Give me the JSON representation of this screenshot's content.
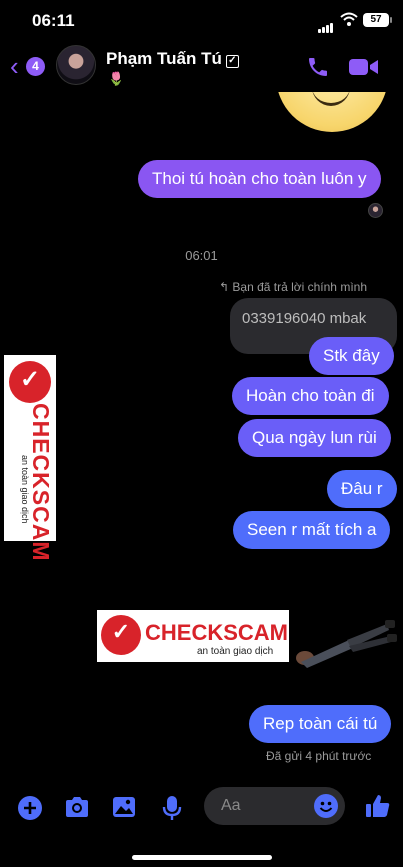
{
  "status_bar": {
    "time": "06:11",
    "battery": "57"
  },
  "header": {
    "back_count": "4",
    "contact_name": "Phạm Tuấn Tú",
    "status_emoji": "🌷"
  },
  "messages": {
    "m1": "Thoi tú hoàn cho toàn luôn y",
    "timestamp": "06:01",
    "reply_note": "↰ Bạn đã trả lời chính mình",
    "quoted": "0339196040 mbak",
    "m2": "Stk đây",
    "m3": "Hoàn cho toàn đi",
    "m4": "Qua ngày lun rùi",
    "m5": "Đâu r",
    "m6": "Seen r mất tích a",
    "m7": "Rep toàn cái tú",
    "sent_status": "Đã gửi 4 phút trước"
  },
  "watermark": {
    "brand": "CHECKSCAM",
    "tagline": "an toàn giao dịch"
  },
  "composer": {
    "placeholder": "Aa"
  },
  "colors": {
    "accent": "#8e5cf7",
    "bubble_top": "#8a56f2",
    "bubble_bottom": "#4f6dfb",
    "brand_red": "#d8232a"
  },
  "icons": [
    "back-icon",
    "verified-icon",
    "phone-icon",
    "video-icon",
    "plus-icon",
    "camera-icon",
    "image-icon",
    "mic-icon",
    "emoji-icon",
    "like-icon"
  ]
}
